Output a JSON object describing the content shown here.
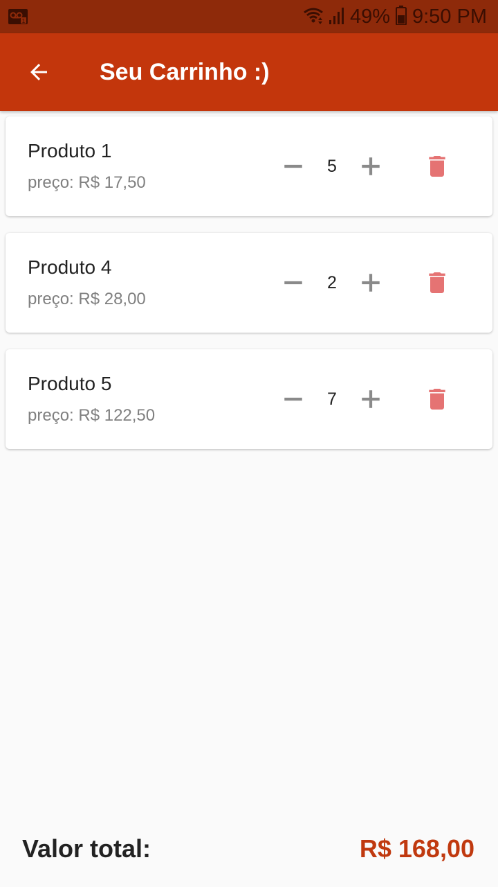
{
  "status_bar": {
    "battery_text": "49%",
    "time": "9:50 PM",
    "voicemail_icon": "voicemail-icon",
    "wifi_icon": "wifi-icon",
    "signal_icon": "signal-icon",
    "battery_icon": "battery-icon"
  },
  "app_bar": {
    "title": "Seu Carrinho :)",
    "back_icon": "arrow-back-icon"
  },
  "cart": {
    "items": [
      {
        "name": "Produto 1",
        "price": "preço: R$ 17,50",
        "quantity": "5"
      },
      {
        "name": "Produto 4",
        "price": "preço: R$ 28,00",
        "quantity": "2"
      },
      {
        "name": "Produto 5",
        "price": "preço: R$ 122,50",
        "quantity": "7"
      }
    ],
    "minus_icon": "minus-icon",
    "plus_icon": "plus-icon",
    "delete_icon": "trash-icon"
  },
  "footer": {
    "total_label": "Valor total:",
    "total_value": "R$ 168,00"
  },
  "colors": {
    "status_bar": "#8e2a0a",
    "app_bar": "#c3360c",
    "accent": "#c0390f",
    "delete": "#e57373",
    "qty_controls": "#8a8a8a",
    "background": "#fafafa"
  }
}
